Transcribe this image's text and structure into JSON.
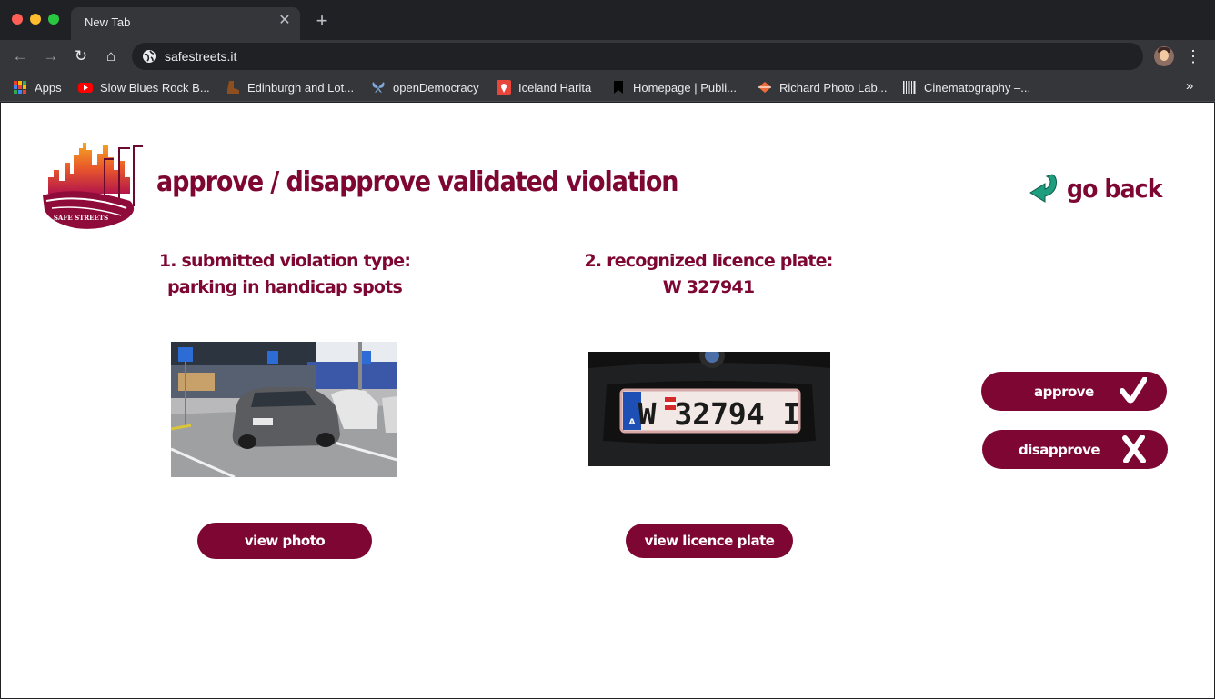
{
  "browser": {
    "tab_title": "New Tab",
    "tab_close_glyph": "✕",
    "new_tab_glyph": "+",
    "url": "safestreets.it",
    "nav": {
      "back_glyph": "←",
      "forward_glyph": "→",
      "reload_glyph": "↻",
      "home_glyph": "⌂",
      "menu_glyph": "⋮"
    },
    "bookmarks": [
      {
        "label": "Apps",
        "icon": "apps-grid-icon"
      },
      {
        "label": "Slow Blues Rock B...",
        "icon": "youtube-icon"
      },
      {
        "label": "Edinburgh and Lot...",
        "icon": "boot-icon"
      },
      {
        "label": "openDemocracy",
        "icon": "butterfly-icon"
      },
      {
        "label": "Iceland Harita",
        "icon": "maps-pin-icon"
      },
      {
        "label": "Homepage | Publi...",
        "icon": "bookmark-icon"
      },
      {
        "label": "Richard Photo Lab...",
        "icon": "diamond-icon"
      },
      {
        "label": "Cinematography –...",
        "icon": "barcode-icon"
      }
    ],
    "more_glyph": "»"
  },
  "page": {
    "title": "approve / disapprove validated violation",
    "go_back_label": "go back",
    "logo_text": "SAFE STREETS",
    "section1": {
      "line1": "1. submitted violation type:",
      "line2": "parking in handicap spots"
    },
    "section2": {
      "line1": "2. recognized licence plate:",
      "line2": "W 327941"
    },
    "plate_text": "W 32794 I",
    "plate_country": "A",
    "view_photo_label": "view photo",
    "view_plate_label": "view licence plate",
    "approve_label": "approve",
    "disapprove_label": "disapprove"
  },
  "colors": {
    "brand": "#7d0633",
    "accent_teal": "#1f9e7f"
  }
}
